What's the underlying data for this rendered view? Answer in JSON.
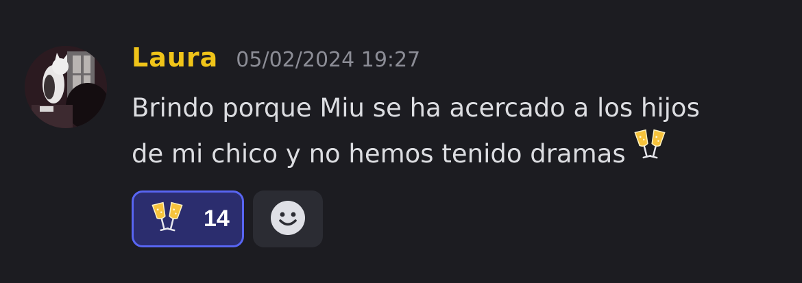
{
  "message": {
    "author": "Laura",
    "timestamp": "05/02/2024 19:27",
    "content_lines": [
      "Brindo porque Miu se ha acercado a los hijos",
      "de mi chico y no hemos tenido dramas"
    ],
    "inline_emoji": "clinking-glasses-icon"
  },
  "reactions": [
    {
      "icon": "clinking-glasses-icon",
      "count": "14",
      "selected": true
    }
  ],
  "add_reaction": {
    "icon": "smiley-icon"
  },
  "colors": {
    "background": "#1c1c21",
    "author": "#f0c419",
    "timestamp": "#8c8d96",
    "text": "#dcdde1",
    "reaction_bg": "#2b2d6e",
    "reaction_border": "#5865f2",
    "add_reaction_bg": "#2b2c33"
  }
}
